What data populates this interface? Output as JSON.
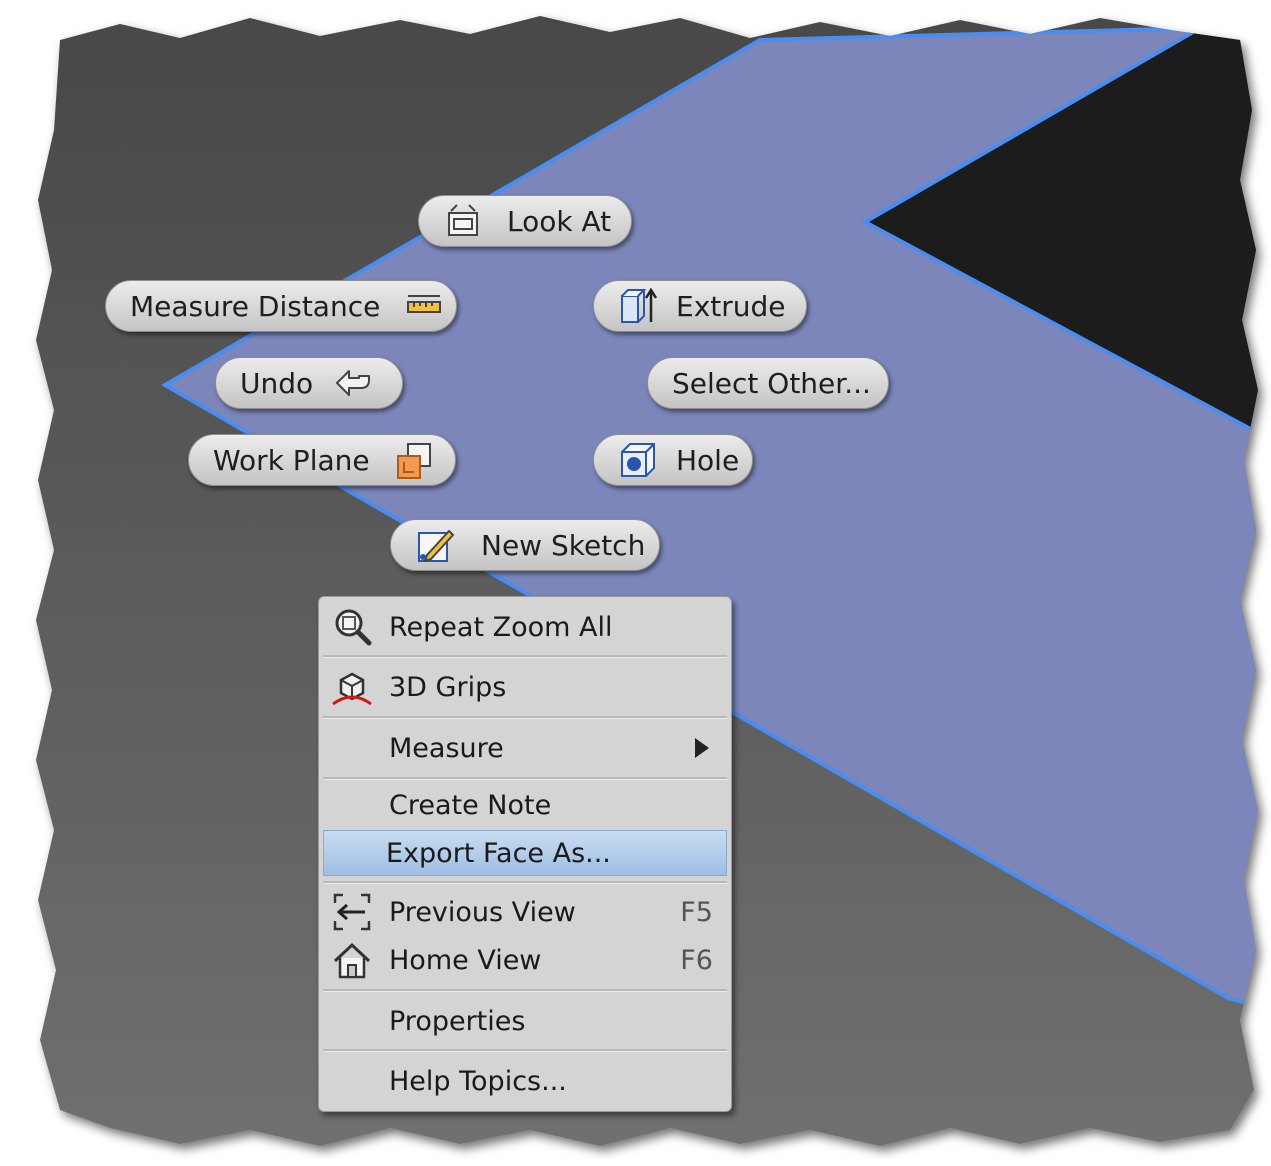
{
  "marking_menu": {
    "look_at": "Look At",
    "measure_distance": "Measure Distance",
    "extrude": "Extrude",
    "undo": "Undo",
    "select_other": "Select Other...",
    "work_plane": "Work Plane",
    "hole": "Hole",
    "new_sketch": "New Sketch"
  },
  "context_menu": {
    "items": [
      {
        "label": "Repeat Zoom All",
        "icon": "zoom-all-icon"
      },
      {
        "label": "3D Grips",
        "icon": "3d-grips-icon"
      },
      {
        "label": "Measure",
        "submenu": true
      },
      {
        "label": "Create Note"
      },
      {
        "label": "Export Face As...",
        "highlighted": true
      },
      {
        "label": "Previous View",
        "shortcut": "F5",
        "icon": "previous-view-icon"
      },
      {
        "label": "Home View",
        "shortcut": "F6",
        "icon": "home-view-icon"
      },
      {
        "label": "Properties"
      },
      {
        "label": "Help Topics..."
      }
    ]
  },
  "colors": {
    "viewport_dark": "#454545",
    "viewport_mid": "#6a6a6a",
    "face_fill": "#7b86bb",
    "face_edge": "#4a8df0",
    "body_dark": "#1c1a1a",
    "highlight": "#a9c6e8"
  }
}
